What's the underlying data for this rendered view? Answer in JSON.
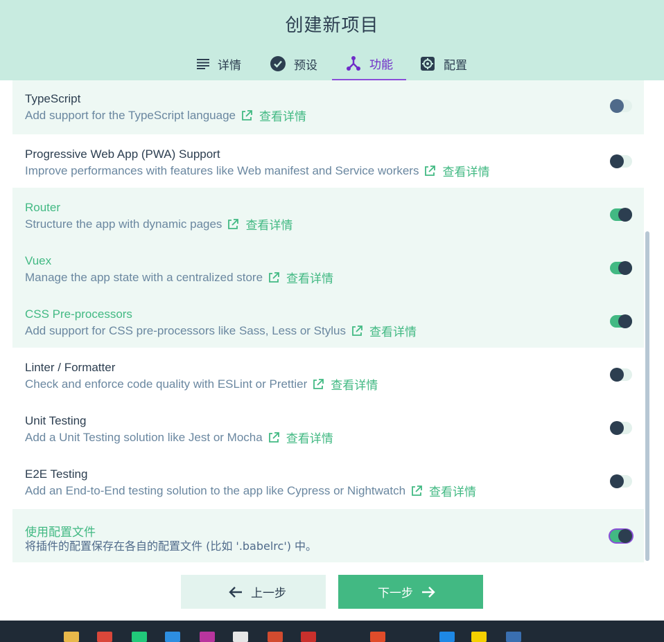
{
  "header": {
    "title": "创建新项目",
    "tabs": [
      {
        "label": "详情",
        "icon": "list-icon"
      },
      {
        "label": "预设",
        "icon": "check-circle-icon"
      },
      {
        "label": "功能",
        "icon": "branch-icon",
        "active": true
      },
      {
        "label": "配置",
        "icon": "gear-icon"
      }
    ]
  },
  "features": [
    {
      "name": "TypeScript",
      "desc": "Add support for the TypeScript language",
      "more": "查看详情",
      "enabled": false
    },
    {
      "name": "Progressive Web App (PWA) Support",
      "desc": "Improve performances with features like Web manifest and Service workers",
      "more": "查看详情",
      "enabled": false
    },
    {
      "name": "Router",
      "desc": "Structure the app with dynamic pages",
      "more": "查看详情",
      "enabled": true
    },
    {
      "name": "Vuex",
      "desc": "Manage the app state with a centralized store",
      "more": "查看详情",
      "enabled": true
    },
    {
      "name": "CSS Pre-processors",
      "desc": "Add support for CSS pre-processors like Sass, Less or Stylus",
      "more": "查看详情",
      "enabled": true
    },
    {
      "name": "Linter / Formatter",
      "desc": "Check and enforce code quality with ESLint or Prettier",
      "more": "查看详情",
      "enabled": false
    },
    {
      "name": "Unit Testing",
      "desc": "Add a Unit Testing solution like Jest or Mocha",
      "more": "查看详情",
      "enabled": false
    },
    {
      "name": "E2E Testing",
      "desc": "Add an End-to-End testing solution to the app like Cypress or Nightwatch",
      "more": "查看详情",
      "enabled": false
    },
    {
      "name": "使用配置文件",
      "desc": "将插件的配置保存在各自的配置文件 (比如 '.babelrc') 中。",
      "enabled": true
    }
  ],
  "actions": {
    "prev_label": "上一步",
    "next_label": "下一步"
  },
  "colors": {
    "accent": "#42b983",
    "header_bg": "#c8ebe0",
    "active_tab": "#6f2cc8",
    "text": "#2c3e50",
    "muted": "#6a87a0"
  }
}
